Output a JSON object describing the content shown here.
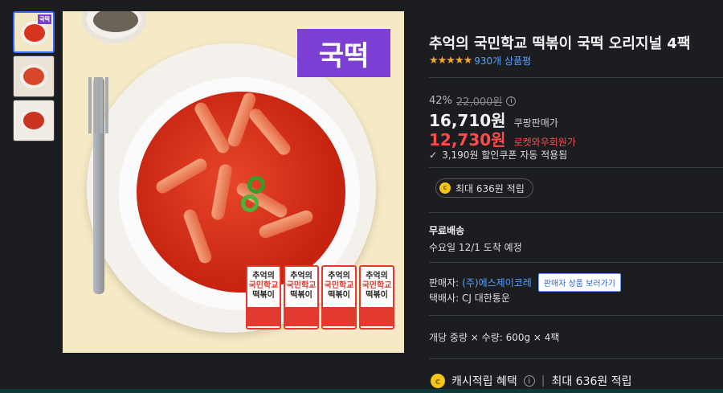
{
  "gallery": {
    "thumb1_tag": "국떡",
    "badge": "국떡",
    "pack_line1": "추억의",
    "pack_line2": "국민학교",
    "pack_line3": "떡볶이"
  },
  "product": {
    "title": "추억의 국민학교 떡볶이 국떡 오리지널 4팩",
    "stars": "★★★★★",
    "review_count": "930개 상품평",
    "discount_pct": "42%",
    "original_price": "22,000원",
    "info_glyph": "i",
    "price": "16,710원",
    "price_label": "쿠팡판매가",
    "member_price": "12,730원",
    "member_label": "로켓와우회원가",
    "coupon_check": "✓",
    "coupon_text": "3,190원 할인쿠폰 자동 적용됨",
    "coin_glyph": "c",
    "reward_pill": "최대 636원 적립",
    "shipping_title": "무료배송",
    "shipping_date": "수요일 12/1 도착 예정",
    "seller_label": "판매자:",
    "seller_name": "(주)에스제이코레",
    "seller_button": "판매자 상품 보러가기",
    "courier": "택배사: CJ 대한통운",
    "weight": "개당 중량 × 수량: 600g × 4팩",
    "cash_label": "캐시적립 혜택",
    "cash_sep": "|",
    "cash_value": "최대 636원 적립"
  },
  "colors": {
    "badge": "#7b3fd3",
    "member_price": "#ff4b4b",
    "link": "#5aa0ff",
    "star": "#f1a62a"
  }
}
